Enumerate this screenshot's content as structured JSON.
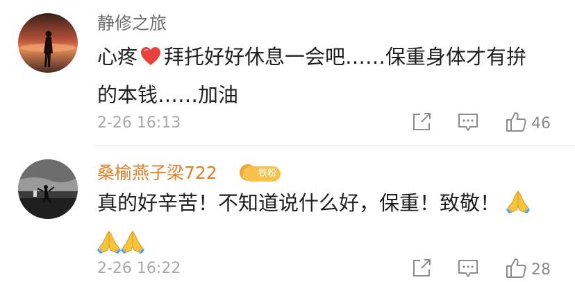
{
  "comments": [
    {
      "username": "静修之旅",
      "text_line1_a": "心疼",
      "text_line1_b": "拜托好好休息一会吧……保重身体才有拚",
      "text_line2": "的本钱……加油",
      "time": "2-26 16:13",
      "likes": "46",
      "username_color": "#6e6e6e",
      "emoji": "red-heart"
    },
    {
      "username": "桑榆燕子梁722",
      "badge": "铁粉",
      "text_line1": "真的好辛苦！不知道说什么好，保重！致敬！",
      "time": "2-26 16:22",
      "likes": "28",
      "username_color": "#e0812a",
      "emoji": "folded-hands"
    }
  ],
  "icons": {
    "share": "share-icon",
    "reply": "comment-icon",
    "like": "thumbs-up-icon"
  }
}
